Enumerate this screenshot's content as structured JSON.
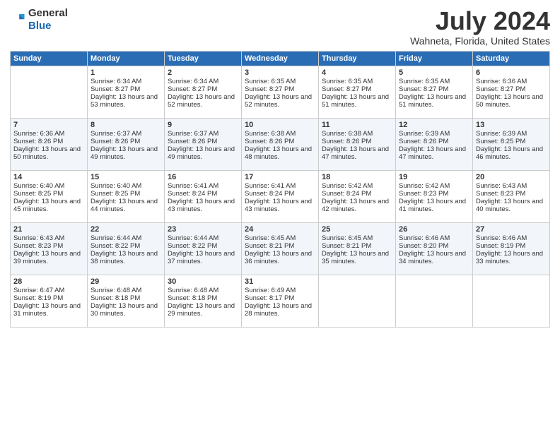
{
  "logo": {
    "general": "General",
    "blue": "Blue"
  },
  "title": "July 2024",
  "subtitle": "Wahneta, Florida, United States",
  "headers": [
    "Sunday",
    "Monday",
    "Tuesday",
    "Wednesday",
    "Thursday",
    "Friday",
    "Saturday"
  ],
  "weeks": [
    [
      {
        "day": "",
        "sunrise": "",
        "sunset": "",
        "daylight": "",
        "empty": true
      },
      {
        "day": "1",
        "sunrise": "Sunrise: 6:34 AM",
        "sunset": "Sunset: 8:27 PM",
        "daylight": "Daylight: 13 hours and 53 minutes."
      },
      {
        "day": "2",
        "sunrise": "Sunrise: 6:34 AM",
        "sunset": "Sunset: 8:27 PM",
        "daylight": "Daylight: 13 hours and 52 minutes."
      },
      {
        "day": "3",
        "sunrise": "Sunrise: 6:35 AM",
        "sunset": "Sunset: 8:27 PM",
        "daylight": "Daylight: 13 hours and 52 minutes."
      },
      {
        "day": "4",
        "sunrise": "Sunrise: 6:35 AM",
        "sunset": "Sunset: 8:27 PM",
        "daylight": "Daylight: 13 hours and 51 minutes."
      },
      {
        "day": "5",
        "sunrise": "Sunrise: 6:35 AM",
        "sunset": "Sunset: 8:27 PM",
        "daylight": "Daylight: 13 hours and 51 minutes."
      },
      {
        "day": "6",
        "sunrise": "Sunrise: 6:36 AM",
        "sunset": "Sunset: 8:27 PM",
        "daylight": "Daylight: 13 hours and 50 minutes."
      }
    ],
    [
      {
        "day": "7",
        "sunrise": "Sunrise: 6:36 AM",
        "sunset": "Sunset: 8:26 PM",
        "daylight": "Daylight: 13 hours and 50 minutes."
      },
      {
        "day": "8",
        "sunrise": "Sunrise: 6:37 AM",
        "sunset": "Sunset: 8:26 PM",
        "daylight": "Daylight: 13 hours and 49 minutes."
      },
      {
        "day": "9",
        "sunrise": "Sunrise: 6:37 AM",
        "sunset": "Sunset: 8:26 PM",
        "daylight": "Daylight: 13 hours and 49 minutes."
      },
      {
        "day": "10",
        "sunrise": "Sunrise: 6:38 AM",
        "sunset": "Sunset: 8:26 PM",
        "daylight": "Daylight: 13 hours and 48 minutes."
      },
      {
        "day": "11",
        "sunrise": "Sunrise: 6:38 AM",
        "sunset": "Sunset: 8:26 PM",
        "daylight": "Daylight: 13 hours and 47 minutes."
      },
      {
        "day": "12",
        "sunrise": "Sunrise: 6:39 AM",
        "sunset": "Sunset: 8:26 PM",
        "daylight": "Daylight: 13 hours and 47 minutes."
      },
      {
        "day": "13",
        "sunrise": "Sunrise: 6:39 AM",
        "sunset": "Sunset: 8:25 PM",
        "daylight": "Daylight: 13 hours and 46 minutes."
      }
    ],
    [
      {
        "day": "14",
        "sunrise": "Sunrise: 6:40 AM",
        "sunset": "Sunset: 8:25 PM",
        "daylight": "Daylight: 13 hours and 45 minutes."
      },
      {
        "day": "15",
        "sunrise": "Sunrise: 6:40 AM",
        "sunset": "Sunset: 8:25 PM",
        "daylight": "Daylight: 13 hours and 44 minutes."
      },
      {
        "day": "16",
        "sunrise": "Sunrise: 6:41 AM",
        "sunset": "Sunset: 8:24 PM",
        "daylight": "Daylight: 13 hours and 43 minutes."
      },
      {
        "day": "17",
        "sunrise": "Sunrise: 6:41 AM",
        "sunset": "Sunset: 8:24 PM",
        "daylight": "Daylight: 13 hours and 43 minutes."
      },
      {
        "day": "18",
        "sunrise": "Sunrise: 6:42 AM",
        "sunset": "Sunset: 8:24 PM",
        "daylight": "Daylight: 13 hours and 42 minutes."
      },
      {
        "day": "19",
        "sunrise": "Sunrise: 6:42 AM",
        "sunset": "Sunset: 8:23 PM",
        "daylight": "Daylight: 13 hours and 41 minutes."
      },
      {
        "day": "20",
        "sunrise": "Sunrise: 6:43 AM",
        "sunset": "Sunset: 8:23 PM",
        "daylight": "Daylight: 13 hours and 40 minutes."
      }
    ],
    [
      {
        "day": "21",
        "sunrise": "Sunrise: 6:43 AM",
        "sunset": "Sunset: 8:23 PM",
        "daylight": "Daylight: 13 hours and 39 minutes."
      },
      {
        "day": "22",
        "sunrise": "Sunrise: 6:44 AM",
        "sunset": "Sunset: 8:22 PM",
        "daylight": "Daylight: 13 hours and 38 minutes."
      },
      {
        "day": "23",
        "sunrise": "Sunrise: 6:44 AM",
        "sunset": "Sunset: 8:22 PM",
        "daylight": "Daylight: 13 hours and 37 minutes."
      },
      {
        "day": "24",
        "sunrise": "Sunrise: 6:45 AM",
        "sunset": "Sunset: 8:21 PM",
        "daylight": "Daylight: 13 hours and 36 minutes."
      },
      {
        "day": "25",
        "sunrise": "Sunrise: 6:45 AM",
        "sunset": "Sunset: 8:21 PM",
        "daylight": "Daylight: 13 hours and 35 minutes."
      },
      {
        "day": "26",
        "sunrise": "Sunrise: 6:46 AM",
        "sunset": "Sunset: 8:20 PM",
        "daylight": "Daylight: 13 hours and 34 minutes."
      },
      {
        "day": "27",
        "sunrise": "Sunrise: 6:46 AM",
        "sunset": "Sunset: 8:19 PM",
        "daylight": "Daylight: 13 hours and 33 minutes."
      }
    ],
    [
      {
        "day": "28",
        "sunrise": "Sunrise: 6:47 AM",
        "sunset": "Sunset: 8:19 PM",
        "daylight": "Daylight: 13 hours and 31 minutes."
      },
      {
        "day": "29",
        "sunrise": "Sunrise: 6:48 AM",
        "sunset": "Sunset: 8:18 PM",
        "daylight": "Daylight: 13 hours and 30 minutes."
      },
      {
        "day": "30",
        "sunrise": "Sunrise: 6:48 AM",
        "sunset": "Sunset: 8:18 PM",
        "daylight": "Daylight: 13 hours and 29 minutes."
      },
      {
        "day": "31",
        "sunrise": "Sunrise: 6:49 AM",
        "sunset": "Sunset: 8:17 PM",
        "daylight": "Daylight: 13 hours and 28 minutes."
      },
      {
        "day": "",
        "sunrise": "",
        "sunset": "",
        "daylight": "",
        "empty": true
      },
      {
        "day": "",
        "sunrise": "",
        "sunset": "",
        "daylight": "",
        "empty": true
      },
      {
        "day": "",
        "sunrise": "",
        "sunset": "",
        "daylight": "",
        "empty": true
      }
    ]
  ]
}
